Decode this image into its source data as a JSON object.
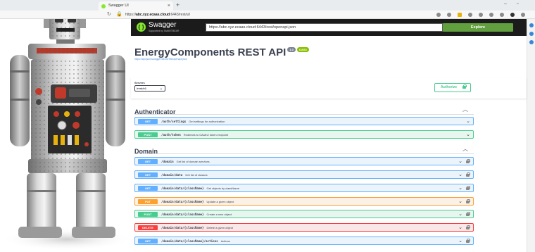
{
  "browser": {
    "tab_title": "Swagger UI",
    "tab_close": "×",
    "new_tab": "+",
    "url_prefix": "https://",
    "url_host": "abc.xyz.ecaas.cloud",
    "url_path": ":6443/rest/ui/"
  },
  "swagger": {
    "brand": "Swagger",
    "brand_sub": "Supported by SMARTBEAR",
    "spec_url": "https://abc.xyz.ecaas.cloud:6443/rest/openapi.json",
    "explore_label": "Explore",
    "title": "EnergyComponents REST API",
    "version_badge": "1.0",
    "oas_badge": "OAS3",
    "spec_link": "https://api.json/swagger.6443/rest/openapi.json",
    "servers_label": "Servers",
    "server_value": "/rest/v1",
    "authorize_label": "Authorize"
  },
  "groups": {
    "authenticator": "Authenticator",
    "domain": "Domain"
  },
  "operations": {
    "auth": [
      {
        "method": "GET",
        "path": "/auth/settings",
        "desc": "Get settings for authorization"
      },
      {
        "method": "POST",
        "path": "/auth/token",
        "desc": "Redirects to OAuth2 token endpoint"
      }
    ],
    "domain": [
      {
        "method": "GET",
        "path": "/domain",
        "desc": "Get list of domain services"
      },
      {
        "method": "GET",
        "path": "/domain/data",
        "desc": "Get list of classes"
      },
      {
        "method": "GET",
        "path": "/domain/data/{className}",
        "desc": "Get objects by className"
      },
      {
        "method": "PUT",
        "path": "/domain/data/{className}",
        "desc": "Update a given object"
      },
      {
        "method": "POST",
        "path": "/domain/data/{className}",
        "desc": "Create a new object"
      },
      {
        "method": "DELETE",
        "path": "/domain/data/{className}",
        "desc": "Delete a given object"
      },
      {
        "method": "GET",
        "path": "/domain/data/{className}/actions",
        "desc": "Actions"
      }
    ]
  },
  "colors": {
    "get": "#61affe",
    "post": "#49cc90",
    "put": "#fca130",
    "delete": "#f93e3e",
    "swagger_green": "#85ea2d",
    "topbar": "#1b1b1b"
  }
}
